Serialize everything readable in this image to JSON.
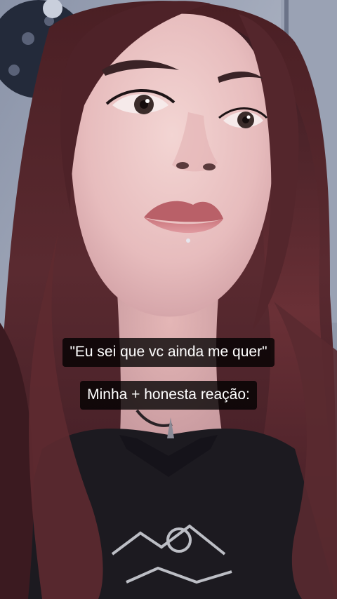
{
  "overlay": {
    "caption_1": "\"Eu sei que vc ainda me quer\"",
    "caption_2": "Minha + honesta reação:"
  }
}
